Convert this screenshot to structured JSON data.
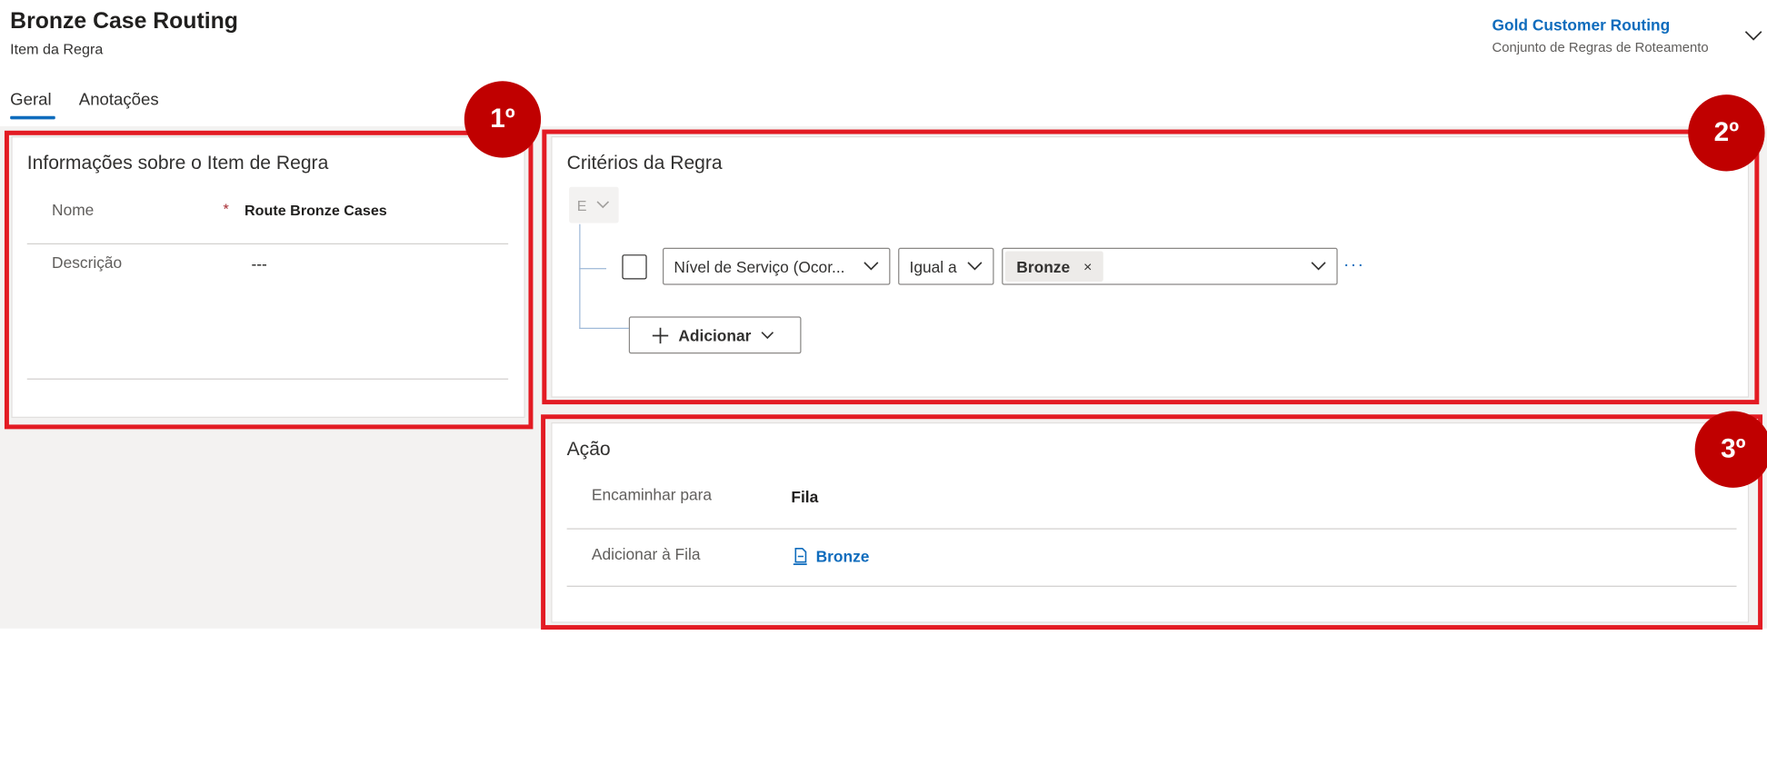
{
  "header": {
    "title": "Bronze Case Routing",
    "entity_type": "Item da Regra",
    "ruleset_name": "Gold Customer Routing",
    "ruleset_type": "Conjunto de Regras de Roteamento"
  },
  "tabs": [
    {
      "label": "Geral",
      "selected": true
    },
    {
      "label": "Anotações",
      "selected": false
    }
  ],
  "info_section": {
    "title": "Informações sobre o Item de Regra",
    "name_label": "Nome",
    "required_mark": "*",
    "name_value": "Route Bronze Cases",
    "description_label": "Descrição",
    "description_value": "---"
  },
  "criteria_section": {
    "title": "Critérios da Regra",
    "group_operator": "E",
    "condition": {
      "field": "Nível de Serviço (Ocor...",
      "operator": "Igual a",
      "value_tag": "Bronze",
      "remove_glyph": "×",
      "more_glyph": "···"
    },
    "add_button": "Adicionar"
  },
  "action_section": {
    "title": "Ação",
    "route_to_label": "Encaminhar para",
    "route_to_value": "Fila",
    "add_to_queue_label": "Adicionar à Fila",
    "add_to_queue_value": "Bronze"
  },
  "annotations": [
    "1º",
    "2º",
    "3º"
  ],
  "colors": {
    "highlight": "#e31b23",
    "badge": "#c00000",
    "link": "#0f6cbd",
    "canvas": "#f3f2f1"
  },
  "icons": [
    "chevron-down-icon",
    "plus-icon",
    "queue-icon",
    "close-icon",
    "more-icon"
  ]
}
